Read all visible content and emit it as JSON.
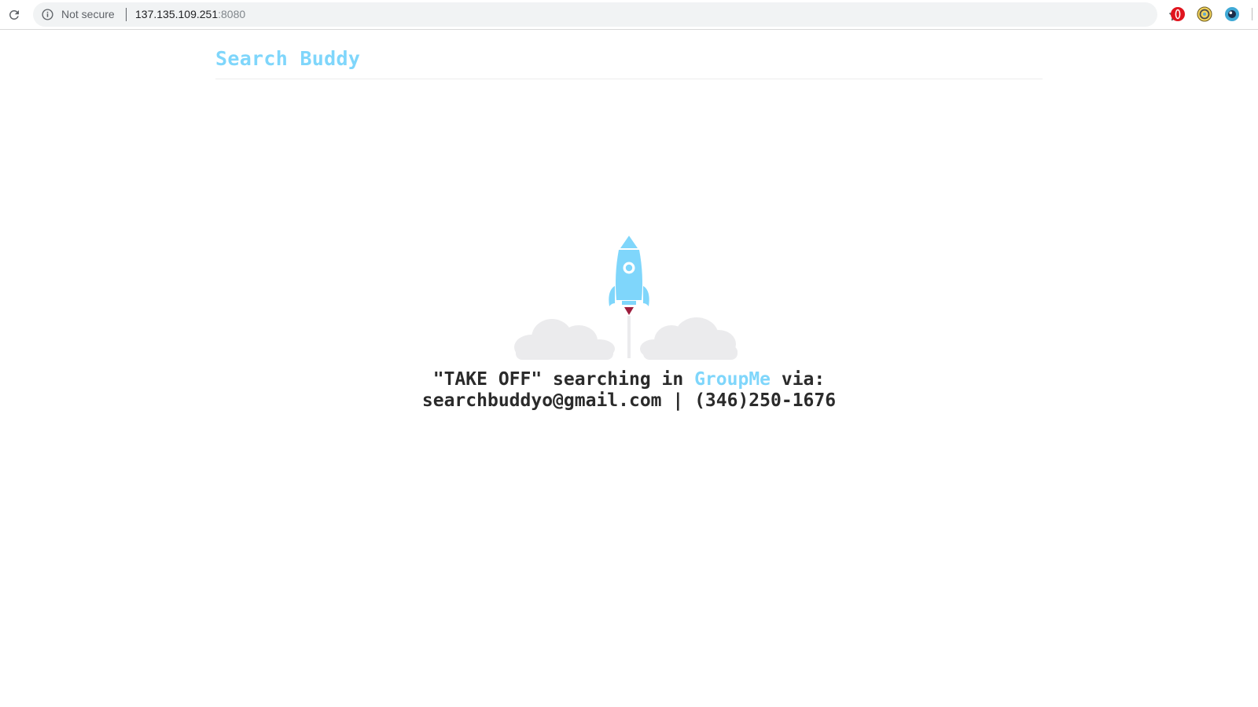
{
  "browser": {
    "security_label": "Not secure",
    "url_host": "137.135.109.251",
    "url_port": ":8080",
    "icons": {
      "reload": "reload-icon",
      "info": "info-icon",
      "bookmark": "star-icon",
      "extensions": [
        "opera-extension-icon",
        "coin-extension-icon",
        "blue-eye-extension-icon"
      ]
    }
  },
  "site": {
    "title": "Search Buddy"
  },
  "hero": {
    "illustration": "rocket-launch-illustration"
  },
  "message": {
    "prefix": "\"TAKE OFF\" searching in ",
    "link_text": "GroupMe",
    "suffix": " via:",
    "contact": "searchbuddyo@gmail.com | (346)250-1676"
  },
  "colors": {
    "accent": "#7fd6fb",
    "rocket_flame": "#9c1c3c",
    "cloud": "#ebebed",
    "text": "#2b2b2b"
  }
}
